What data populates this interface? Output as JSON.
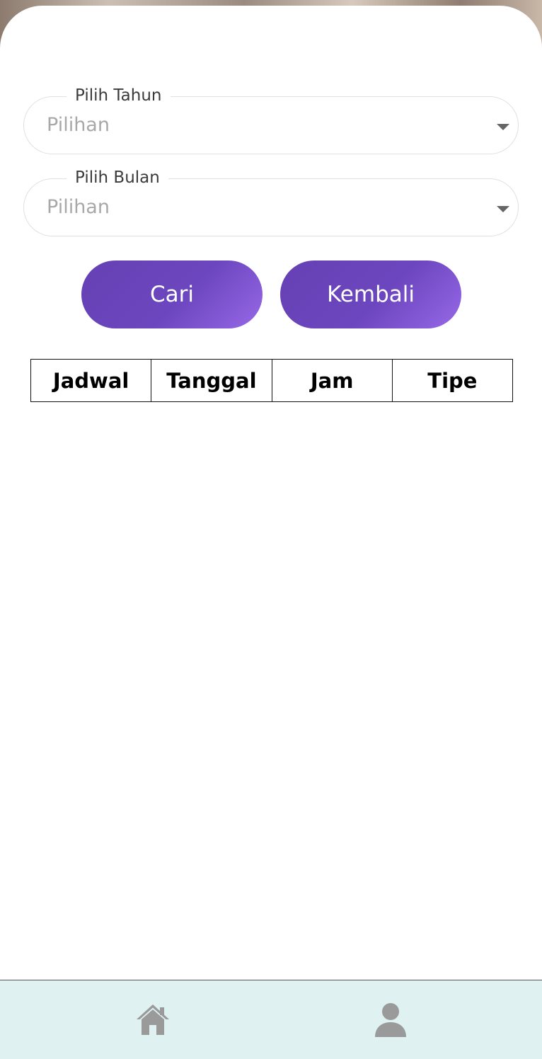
{
  "form": {
    "year_field": {
      "label": "Pilih Tahun",
      "value": "Pilihan"
    },
    "month_field": {
      "label": "Pilih Bulan",
      "value": "Pilihan"
    }
  },
  "buttons": {
    "search_label": "Cari",
    "back_label": "Kembali"
  },
  "table": {
    "columns": [
      "Jadwal",
      "Tanggal",
      "Jam",
      "Tipe"
    ],
    "rows": []
  },
  "bottom_nav": {
    "items": [
      {
        "icon": "home-icon"
      },
      {
        "icon": "user-icon"
      }
    ]
  },
  "colors": {
    "button_gradient_start": "#6541b4",
    "button_gradient_end": "#9768e8",
    "bottom_nav_background": "#dff1f1",
    "nav_icon": "#9a9a9a"
  }
}
